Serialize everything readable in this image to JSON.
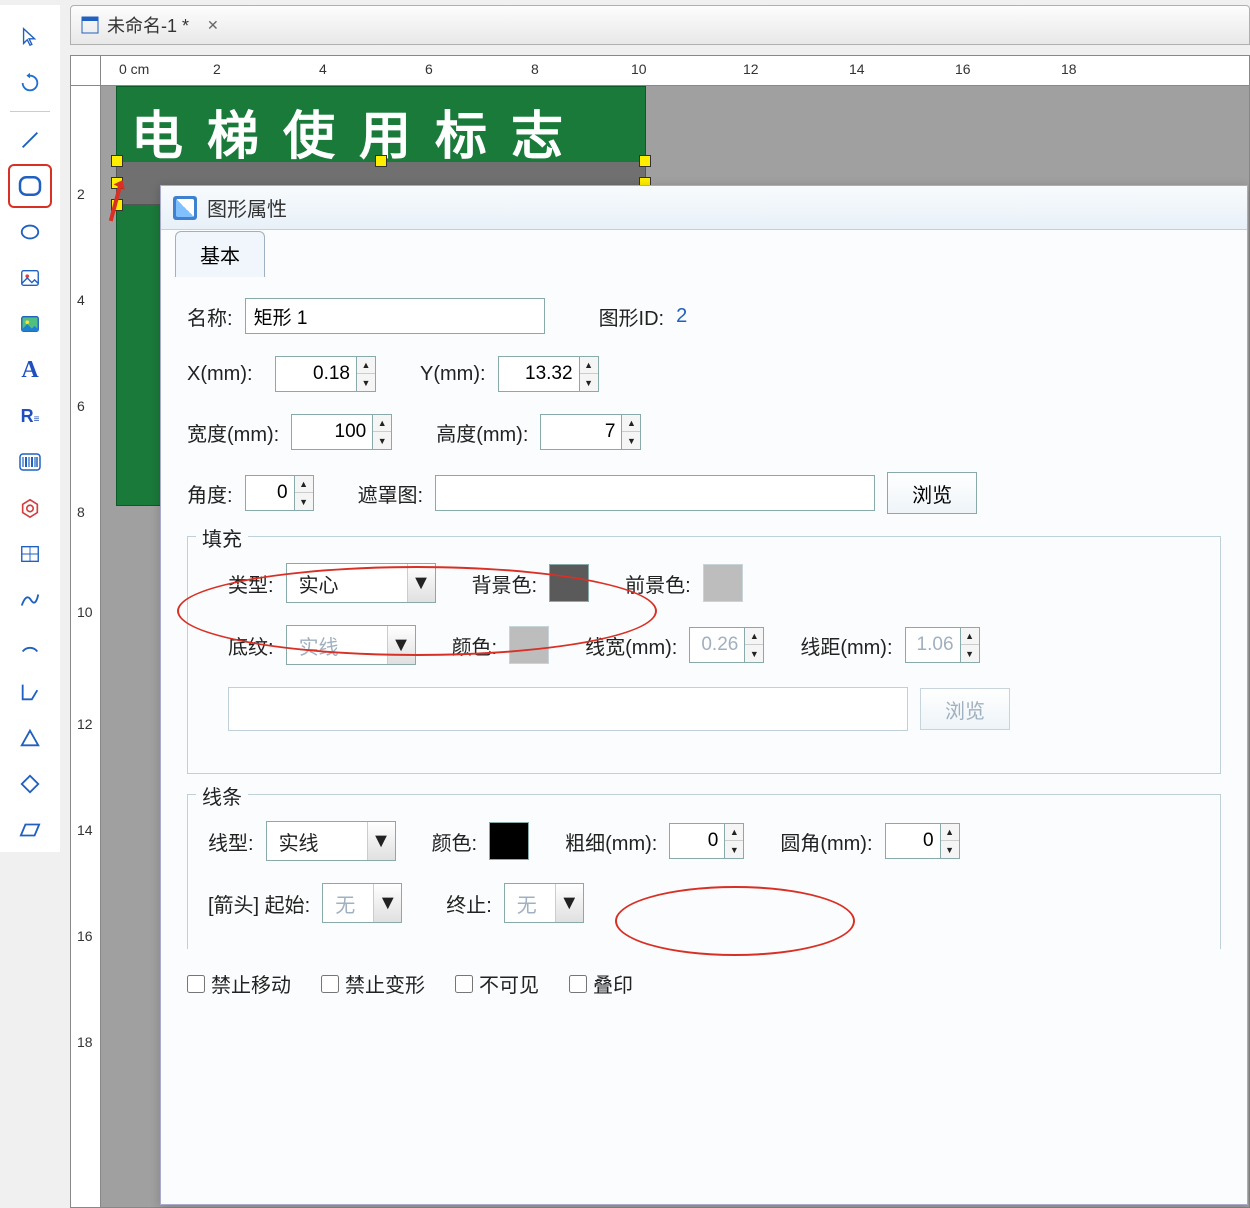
{
  "document": {
    "tab_title": "未命名-1 *"
  },
  "canvas": {
    "text": "电梯使用标志",
    "ruler_unit": "0 cm",
    "ruler_h": [
      "2",
      "4",
      "6",
      "8",
      "10",
      "12",
      "14",
      "16",
      "18"
    ],
    "ruler_v": [
      "2",
      "4",
      "6",
      "8",
      "10",
      "12",
      "14",
      "16",
      "18"
    ]
  },
  "dialog": {
    "title": "图形属性",
    "tab_basic": "基本",
    "name_label": "名称:",
    "name_value": "矩形 1",
    "id_label": "图形ID:",
    "id_value": "2",
    "x_label": "X(mm):",
    "x_value": "0.18",
    "y_label": "Y(mm):",
    "y_value": "13.32",
    "width_label": "宽度(mm):",
    "width_value": "100",
    "height_label": "高度(mm):",
    "height_value": "7",
    "angle_label": "角度:",
    "angle_value": "0",
    "mask_label": "遮罩图:",
    "browse": "浏览",
    "fill": {
      "legend": "填充",
      "type_label": "类型:",
      "type_value": "实心",
      "bg_label": "背景色:",
      "bg_color": "#5a5a5a",
      "fg_label": "前景色:",
      "fg_color": "#b8b8b8",
      "pattern_label": "底纹:",
      "pattern_value": "实线",
      "color_label": "颜色:",
      "pattern_color": "#b8b8b8",
      "lw_label": "线宽(mm):",
      "lw_value": "0.26",
      "ls_label": "线距(mm):",
      "ls_value": "1.06"
    },
    "line": {
      "legend": "线条",
      "type_label": "线型:",
      "type_value": "实线",
      "color_label": "颜色:",
      "color_value": "#000000",
      "weight_label": "粗细(mm):",
      "weight_value": "0",
      "radius_label": "圆角(mm):",
      "radius_value": "0",
      "arrow_label": "[箭头] 起始:",
      "arrow_start": "无",
      "arrow_end_label": "终止:",
      "arrow_end": "无"
    },
    "checks": {
      "lock_move": "禁止移动",
      "lock_resize": "禁止变形",
      "invisible": "不可见",
      "overprint": "叠印"
    }
  }
}
